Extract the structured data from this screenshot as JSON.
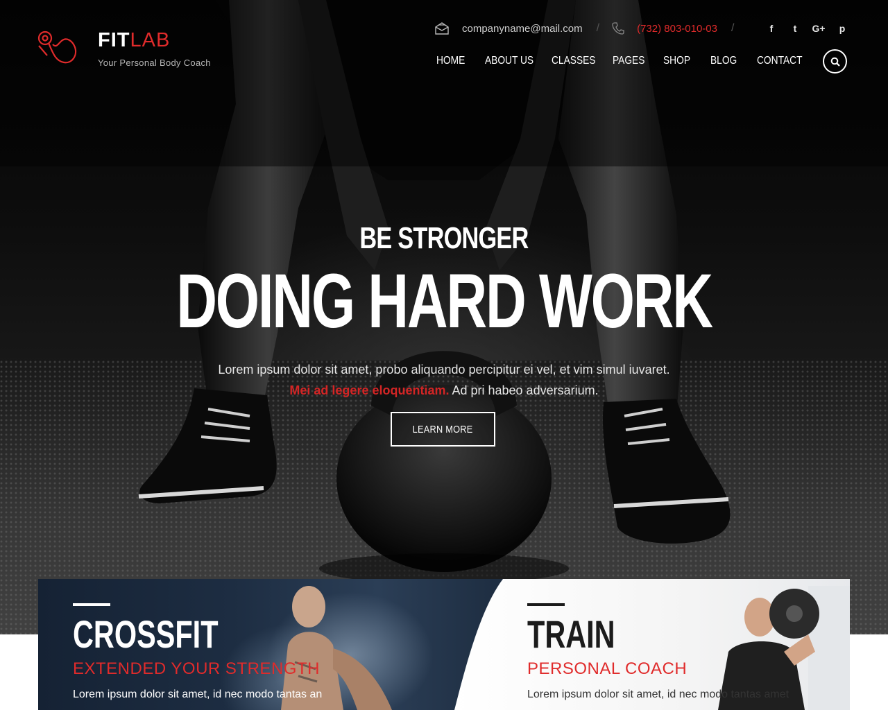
{
  "brand": {
    "name_bold": "FIT",
    "name_light": "LAB",
    "tagline": "Your Personal Body Coach",
    "logo_icon": "flexed-arm-icon",
    "accent_color": "#e02b2b"
  },
  "topbar": {
    "email": "companyname@mail.com",
    "phone": "(732) 803-010-03",
    "separator": "/",
    "mail_icon": "envelope-icon",
    "phone_icon": "phone-icon"
  },
  "social": [
    {
      "name": "facebook-icon",
      "glyph": "f"
    },
    {
      "name": "twitter-icon",
      "glyph": "t"
    },
    {
      "name": "google-plus-icon",
      "glyph": "G+"
    },
    {
      "name": "pinterest-icon",
      "glyph": "p"
    }
  ],
  "nav": {
    "items": [
      "HOME",
      "ABOUT US",
      "CLASSES",
      "PAGES",
      "SHOP",
      "BLOG",
      "CONTACT"
    ],
    "search_icon": "search-icon"
  },
  "hero": {
    "pretitle": "BE STRONGER",
    "title": "DOING HARD WORK",
    "desc_line1": "Lorem ipsum dolor sit amet, probo aliquando percipitur ei vel, et vim simul iuvaret.",
    "desc_highlight": "Mei ad legere eloquentiam.",
    "desc_line2_rest": " Ad pri habeo adversarium.",
    "button": "LEARN MORE"
  },
  "features": [
    {
      "title": "CROSSFIT",
      "subtitle": "EXTENDED YOUR STRENGTH",
      "text": "Lorem ipsum dolor sit amet, id nec modo tantas an"
    },
    {
      "title": "TRAIN",
      "subtitle": "PERSONAL COACH",
      "text": "Lorem ipsum dolor sit amet, id nec modo tantas amet"
    }
  ]
}
